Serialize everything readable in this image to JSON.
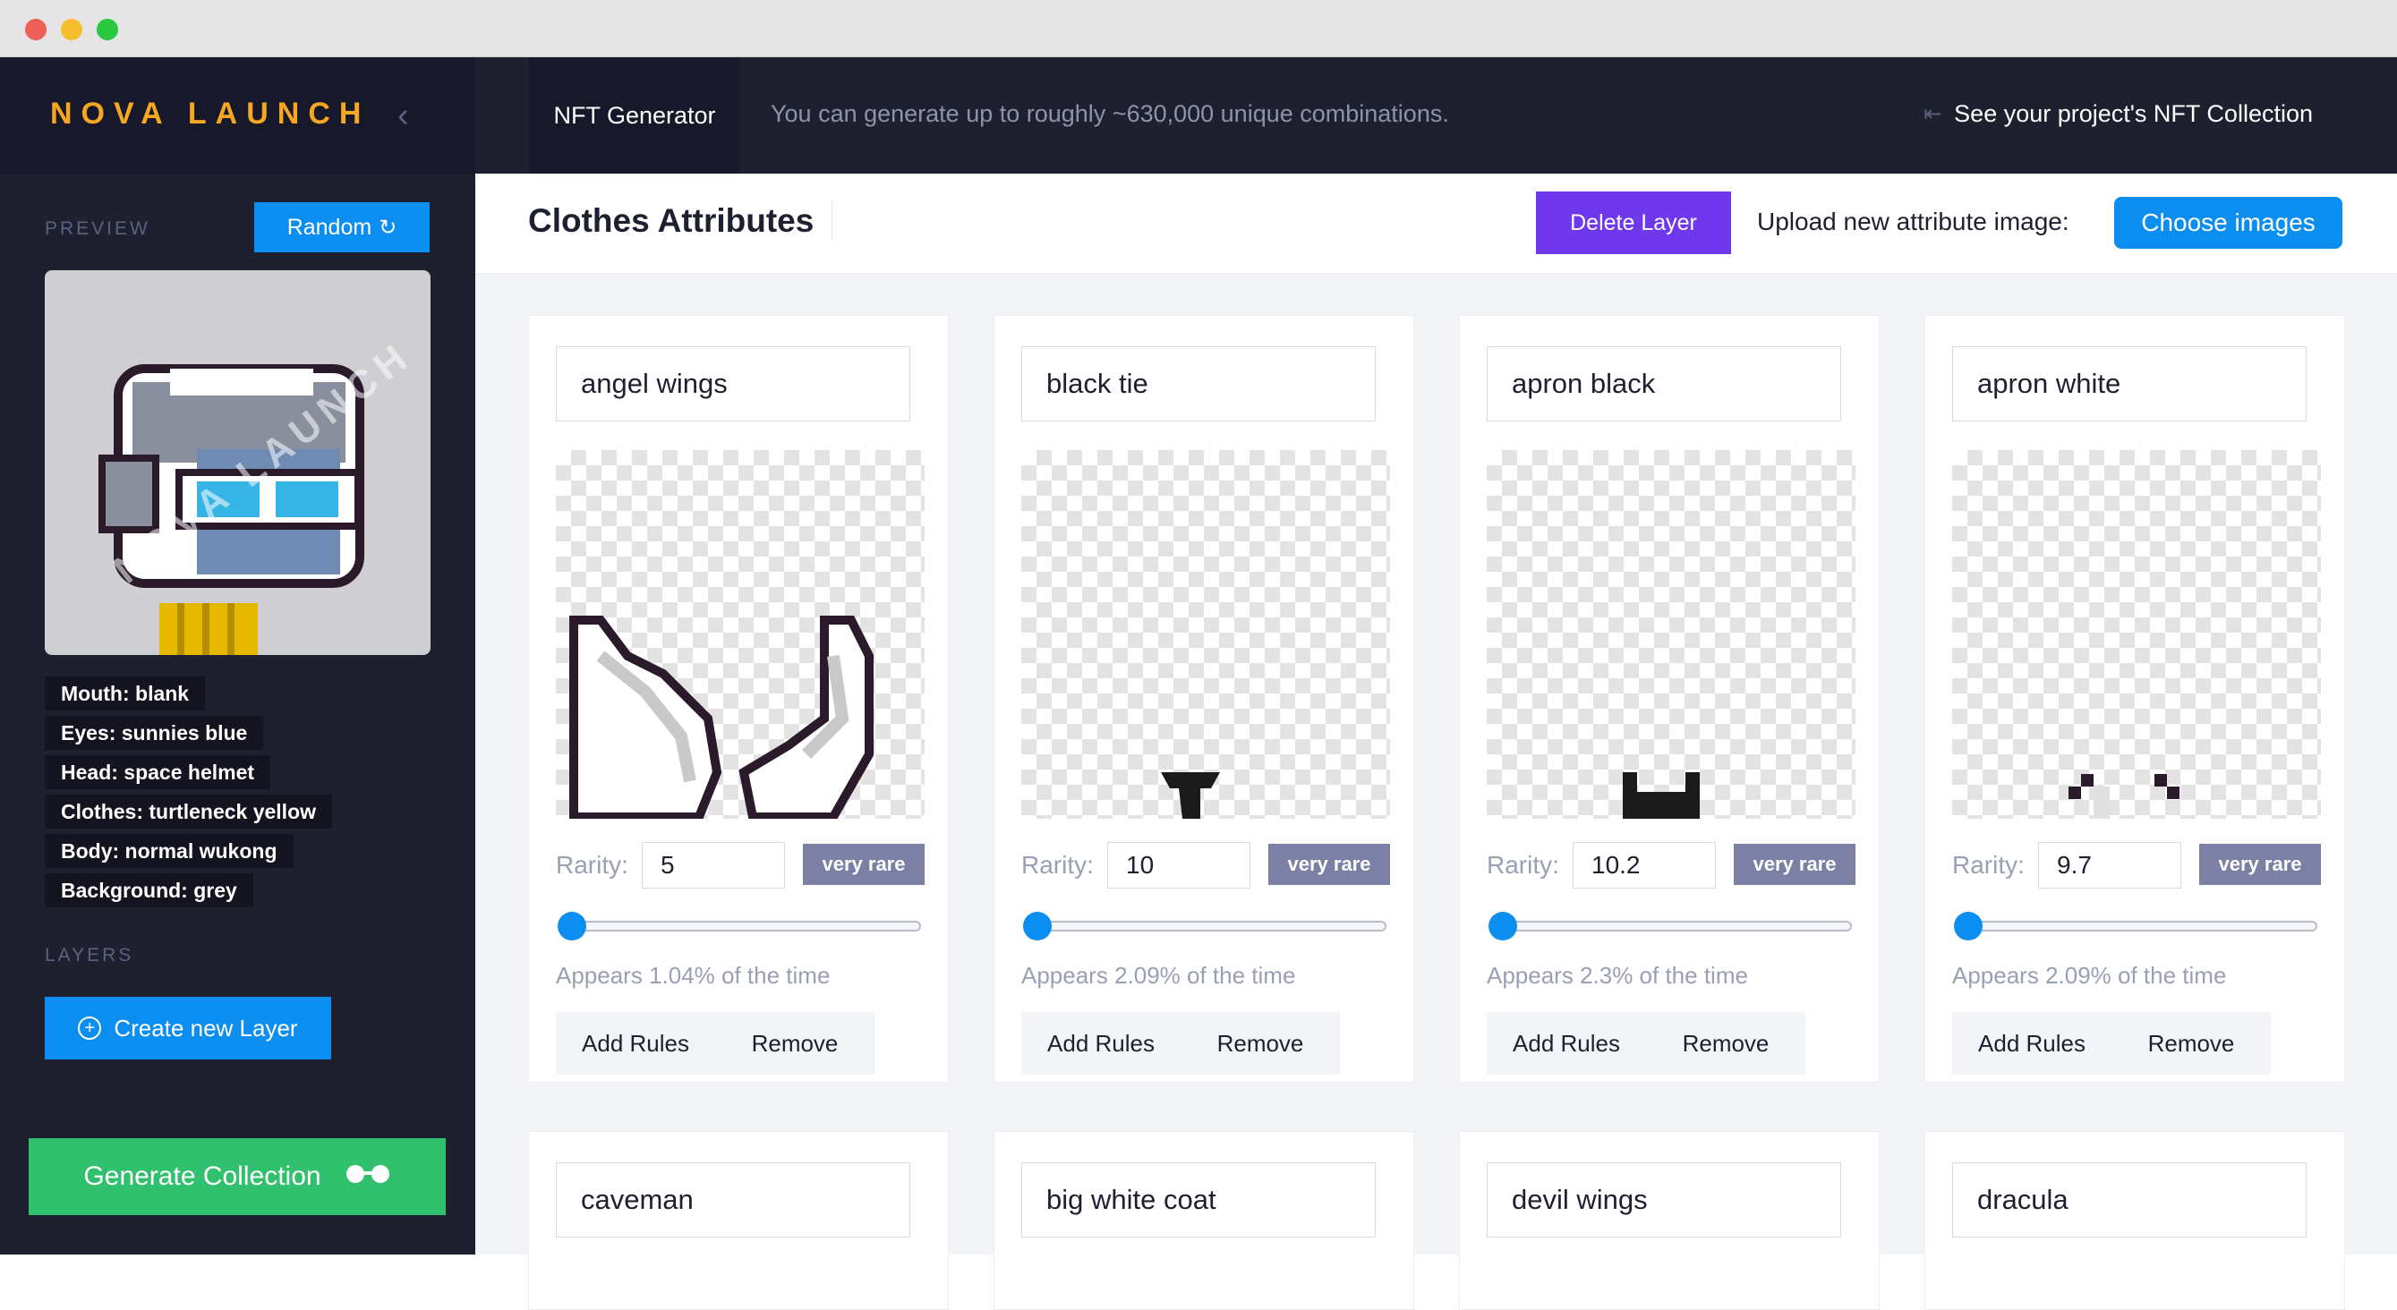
{
  "window": {
    "dots": [
      "#ee5f57",
      "#f6be2f",
      "#2ac840"
    ]
  },
  "sidebar": {
    "logo": "NOVA LAUNCH",
    "collapse_icon": "chevron-left-icon",
    "preview_label": "PREVIEW",
    "random_label": "Random",
    "preview_watermark": "NOVA LAUNCH",
    "attributes": [
      "Mouth: blank",
      "Eyes: sunnies blue",
      "Head: space helmet",
      "Clothes: turtleneck yellow",
      "Body: normal wukong",
      "Background: grey"
    ],
    "layers_label": "LAYERS",
    "create_layer_label": "Create new Layer",
    "generate_label": "Generate Collection"
  },
  "topbar": {
    "active_tab": "NFT Generator",
    "message": "You can generate up to roughly ~630,000  unique combinations.",
    "collection_link": "See your project's NFT Collection"
  },
  "header": {
    "title": "Clothes Attributes",
    "delete_label": "Delete Layer",
    "upload_label": "Upload new attribute image:",
    "choose_label": "Choose images"
  },
  "labels": {
    "rarity": "Rarity:",
    "add_rules": "Add Rules",
    "remove": "Remove"
  },
  "colors": {
    "sidebar_bg": "#1e2030",
    "accent_blue": "#0b8ef0",
    "delete_purple": "#6f38ec",
    "generate_green": "#31c06d",
    "badge_gray": "#7c80a5",
    "logo_orange": "#f5a623"
  },
  "cards": [
    {
      "name": "angel wings",
      "rarity": "5",
      "badge": "very rare",
      "appears": "Appears 1.04% of the time"
    },
    {
      "name": "black tie",
      "rarity": "10",
      "badge": "very rare",
      "appears": "Appears 2.09% of the time"
    },
    {
      "name": "apron black",
      "rarity": "10.2",
      "badge": "very rare",
      "appears": "Appears 2.3% of the time"
    },
    {
      "name": "apron white",
      "rarity": "9.7",
      "badge": "very rare",
      "appears": "Appears 2.09% of the time"
    },
    {
      "name": "caveman"
    },
    {
      "name": "big white coat"
    },
    {
      "name": "devil wings"
    },
    {
      "name": "dracula"
    }
  ]
}
